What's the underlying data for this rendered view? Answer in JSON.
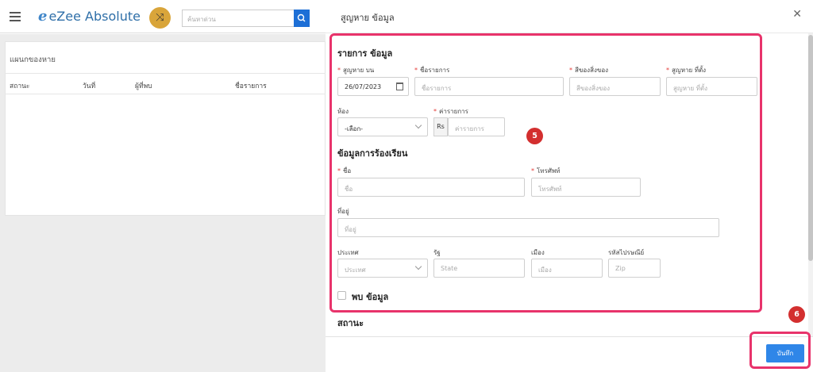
{
  "app": {
    "logo_mark": "e",
    "logo_text": "eZee Absolute",
    "search_placeholder": "ค้นหาด่วน"
  },
  "background": {
    "panel_title": "แผนกของหาย",
    "columns": [
      "สถานะ",
      "วันที่",
      "ผู้ที่พบ",
      "ชื่อรายการ"
    ]
  },
  "modal": {
    "title": "สูญหาย ข้อมูล",
    "close_symbol": "✕",
    "item_section": {
      "title": "รายการ ข้อมูล",
      "lost_on": {
        "label": "สูญหาย บน",
        "value": "26/07/2023"
      },
      "item_name": {
        "label": "ชื่อรายการ",
        "placeholder": "ชื่อรายการ"
      },
      "color": {
        "label": "สีของสิ่งของ",
        "placeholder": "สีของสิ่งของ"
      },
      "lost_location": {
        "label": "สูญหาย ที่ตั้ง",
        "placeholder": "สูญหาย ที่ตั้ง"
      },
      "room": {
        "label": "ห้อง",
        "value": "-เลือก-"
      },
      "item_value": {
        "label": "ค่ารายการ",
        "currency": "Rs",
        "placeholder": "ค่ารายการ"
      }
    },
    "complaint_section": {
      "title": "ข้อมูลการร้องเรียน",
      "name": {
        "label": "ชื่อ",
        "placeholder": "ชื่อ"
      },
      "phone": {
        "label": "โทรศัพท์",
        "placeholder": "โทรศัพท์"
      },
      "address": {
        "label": "ที่อยู่",
        "placeholder": "ที่อยู่"
      },
      "country": {
        "label": "ประเทศ",
        "placeholder": "ประเทศ"
      },
      "state": {
        "label": "รัฐ",
        "placeholder": "State"
      },
      "city": {
        "label": "เมือง",
        "placeholder": "เมือง"
      },
      "zip": {
        "label": "รหัสไปรษณีย์",
        "placeholder": "Zip"
      }
    },
    "found_checkbox_label": "พบ ข้อมูล",
    "status_title": "สถานะ",
    "save_label": "บันทึก"
  },
  "annotations": {
    "callout_5": "5",
    "callout_6": "6",
    "highlight_color": "#e8336b",
    "callout_color": "#d32f2f"
  }
}
